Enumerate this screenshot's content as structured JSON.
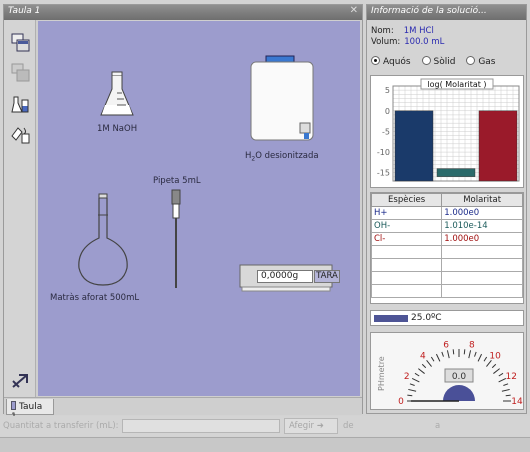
{
  "left_window": {
    "title": "Taula 1",
    "tab_label": "Taula 1",
    "items": {
      "naoh": "1M NaOH",
      "water": "H",
      "water_sub": "2",
      "water_rest": "O desionitzada",
      "pipette": "Pipeta 5mL",
      "flask": "Matràs aforat 500mL",
      "balance_value": "0,0000g",
      "tara": "TARA"
    }
  },
  "right_window": {
    "title": "Informació de la solució...",
    "nom_label": "Nom:",
    "nom_value": "1M HCl",
    "volum_label": "Volum:",
    "volum_value": "100.0 mL",
    "phase_options": [
      {
        "label": "Aquós",
        "selected": true
      },
      {
        "label": "Sòlid",
        "selected": false
      },
      {
        "label": "Gas",
        "selected": false
      }
    ],
    "species_headers": [
      "Espècies",
      "Molaritat"
    ],
    "species": [
      {
        "name": "H+",
        "value": "1.000e0",
        "color": "#1a2a8a"
      },
      {
        "name": "OH-",
        "value": "1.010e-14",
        "color": "#1a5a5a"
      },
      {
        "name": "Cl-",
        "value": "1.000e0",
        "color": "#a01010"
      }
    ],
    "temperature": "25.0ºC",
    "phmeter_label": "PHmetre",
    "ph_reading": "0.0"
  },
  "bottom": {
    "quantity_label": "Quantitat a transferir (mL):",
    "add_button": "Afegir",
    "de": "de",
    "a": "a"
  },
  "chart_data": {
    "type": "bar",
    "title": "log( Molaritat )",
    "categories": [
      "H+",
      "OH-",
      "Cl-"
    ],
    "values": [
      0,
      -14,
      0
    ],
    "colors": [
      "#1a3a6a",
      "#2a6a6a",
      "#9a1a2a"
    ],
    "ylim": [
      -17,
      6
    ],
    "yticks": [
      5,
      0,
      -5,
      -10,
      -15
    ],
    "grid": true
  },
  "phmeter_scale": [
    "0",
    "2",
    "4",
    "6",
    "8",
    "10",
    "12",
    "14"
  ]
}
